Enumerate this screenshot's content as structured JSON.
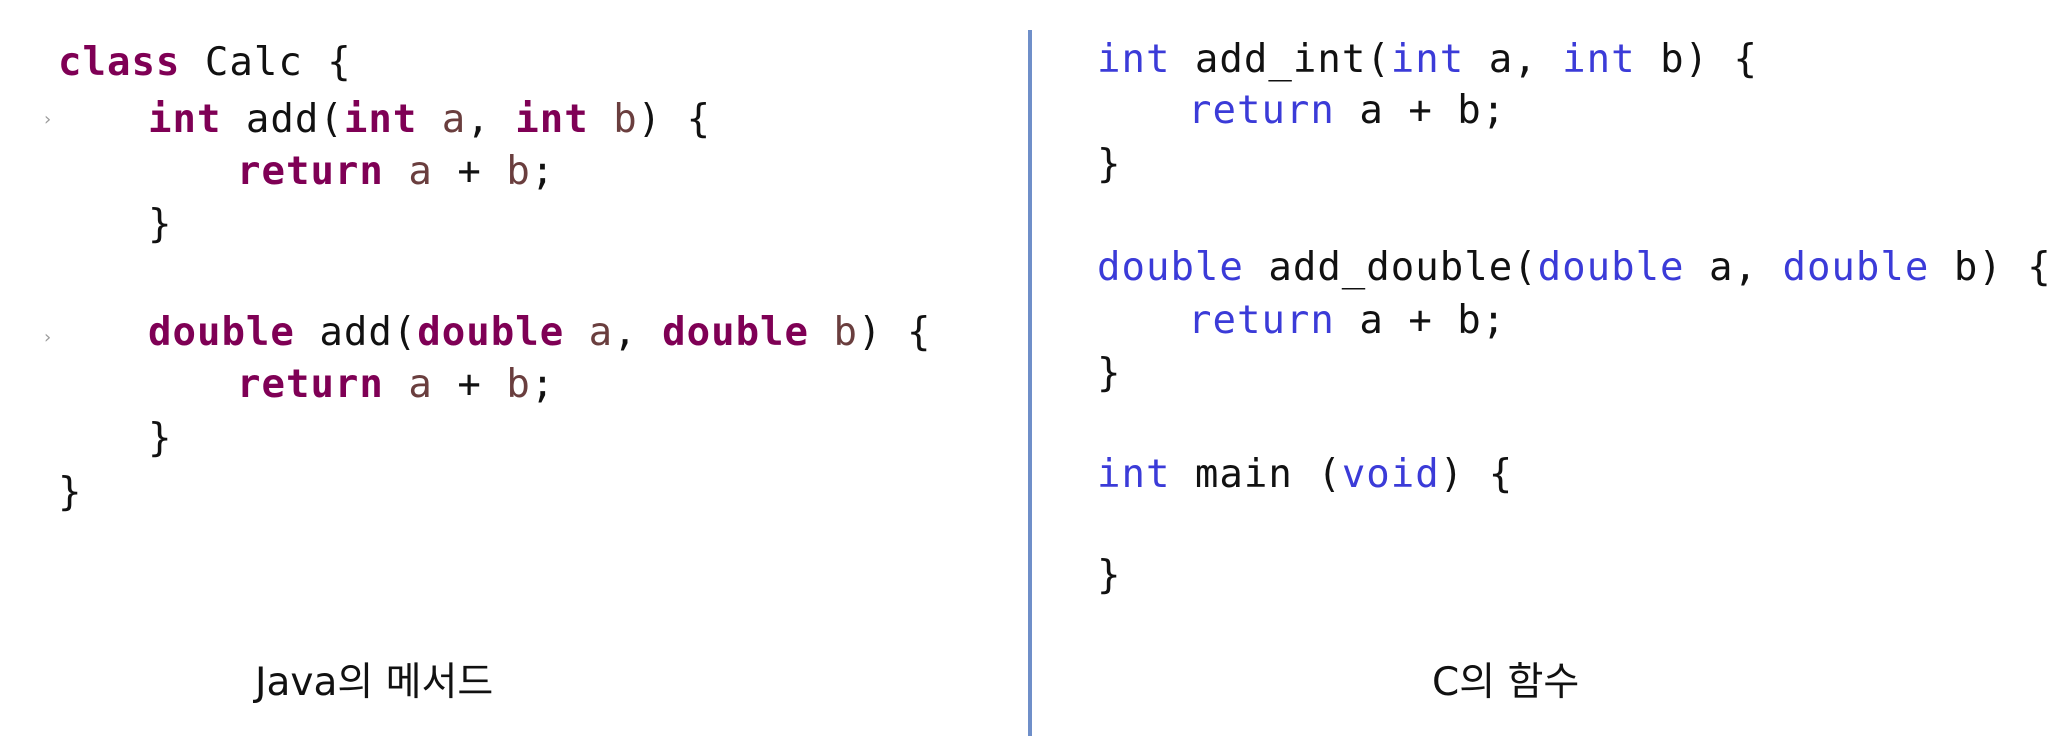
{
  "colors": {
    "java_keyword": "#7f0055",
    "java_param": "#6a3e3e",
    "java_plain": "#111111",
    "c_keyword": "#3b3bd8",
    "c_plain": "#111111",
    "divider": "#6f8fc9"
  },
  "java": {
    "lines": [
      [
        {
          "text": "class",
          "kind": "kw"
        },
        {
          "text": " Calc {",
          "kind": "plain"
        }
      ],
      [
        {
          "text": "int",
          "kind": "kw"
        },
        {
          "text": " add(",
          "kind": "plain"
        },
        {
          "text": "int",
          "kind": "kw"
        },
        {
          "text": " ",
          "kind": "plain"
        },
        {
          "text": "a",
          "kind": "param"
        },
        {
          "text": ", ",
          "kind": "plain"
        },
        {
          "text": "int",
          "kind": "kw"
        },
        {
          "text": " ",
          "kind": "plain"
        },
        {
          "text": "b",
          "kind": "param"
        },
        {
          "text": ") {",
          "kind": "plain"
        }
      ],
      [
        {
          "text": "return",
          "kind": "kw"
        },
        {
          "text": " ",
          "kind": "plain"
        },
        {
          "text": "a",
          "kind": "param"
        },
        {
          "text": " + ",
          "kind": "plain"
        },
        {
          "text": "b",
          "kind": "param"
        },
        {
          "text": ";",
          "kind": "plain"
        }
      ],
      [
        {
          "text": "}",
          "kind": "plain"
        }
      ],
      [],
      [
        {
          "text": "double",
          "kind": "kw"
        },
        {
          "text": " add(",
          "kind": "plain"
        },
        {
          "text": "double",
          "kind": "kw"
        },
        {
          "text": " ",
          "kind": "plain"
        },
        {
          "text": "a",
          "kind": "param"
        },
        {
          "text": ", ",
          "kind": "plain"
        },
        {
          "text": "double",
          "kind": "kw"
        },
        {
          "text": " ",
          "kind": "plain"
        },
        {
          "text": "b",
          "kind": "param"
        },
        {
          "text": ") {",
          "kind": "plain"
        }
      ],
      [
        {
          "text": "return",
          "kind": "kw"
        },
        {
          "text": " ",
          "kind": "plain"
        },
        {
          "text": "a",
          "kind": "param"
        },
        {
          "text": " + ",
          "kind": "plain"
        },
        {
          "text": "b",
          "kind": "param"
        },
        {
          "text": ";",
          "kind": "plain"
        }
      ],
      [
        {
          "text": "}",
          "kind": "plain"
        }
      ],
      [
        {
          "text": "}",
          "kind": "plain"
        }
      ]
    ],
    "caption": "Java의 메서드"
  },
  "c": {
    "lines": [
      [
        {
          "text": "int",
          "kind": "kw"
        },
        {
          "text": " add_int(",
          "kind": "plain"
        },
        {
          "text": "int",
          "kind": "kw"
        },
        {
          "text": " a, ",
          "kind": "plain"
        },
        {
          "text": "int",
          "kind": "kw"
        },
        {
          "text": " b) {",
          "kind": "plain"
        }
      ],
      [
        {
          "text": "return",
          "kind": "kw"
        },
        {
          "text": " a + b;",
          "kind": "plain"
        }
      ],
      [
        {
          "text": "}",
          "kind": "plain"
        }
      ],
      [],
      [
        {
          "text": "double",
          "kind": "kw"
        },
        {
          "text": " add_double(",
          "kind": "plain"
        },
        {
          "text": "double",
          "kind": "kw"
        },
        {
          "text": " a, ",
          "kind": "plain"
        },
        {
          "text": "double",
          "kind": "kw"
        },
        {
          "text": " b) {",
          "kind": "plain"
        }
      ],
      [
        {
          "text": "return",
          "kind": "kw"
        },
        {
          "text": " a + b;",
          "kind": "plain"
        }
      ],
      [
        {
          "text": "}",
          "kind": "plain"
        }
      ],
      [],
      [
        {
          "text": "int",
          "kind": "kw"
        },
        {
          "text": " main (",
          "kind": "plain"
        },
        {
          "text": "void",
          "kind": "kw"
        },
        {
          "text": ") {",
          "kind": "plain"
        }
      ],
      [],
      [
        {
          "text": "}",
          "kind": "plain"
        }
      ]
    ],
    "caption": "C의 함수"
  },
  "fold_marks": [
    "›",
    "›"
  ]
}
